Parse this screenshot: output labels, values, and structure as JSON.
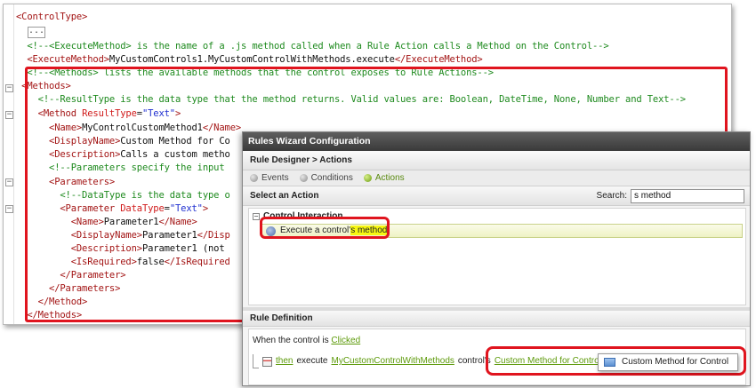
{
  "xml": {
    "lines": [
      {
        "parts": [
          {
            "c": "tag",
            "t": "<ControlType>"
          }
        ]
      },
      {
        "parts": []
      },
      {
        "parts": [
          {
            "c": "cmt",
            "t": "  <!--<ExecuteMethod> is the name of a .js method called when a Rule Action calls a Method on the Control-->"
          }
        ]
      },
      {
        "parts": [
          {
            "c": "tag",
            "t": "  <ExecuteMethod>"
          },
          {
            "c": "txt",
            "t": "MyCustomControls1.MyCustomControlWithMethods.execute"
          },
          {
            "c": "tag",
            "t": "</ExecuteMethod>"
          }
        ]
      },
      {
        "parts": [
          {
            "c": "cmt",
            "t": "  <!--<Methods> lists the available methods that the control exposes to Rule Actions-->"
          }
        ]
      },
      {
        "parts": [
          {
            "c": "tag",
            "t": " <Methods>"
          }
        ]
      },
      {
        "parts": [
          {
            "c": "cmt",
            "t": "    <!--ResultType is the data type that the method returns. Valid values are: Boolean, DateTime, None, Number and Text-->"
          }
        ]
      },
      {
        "parts": [
          {
            "c": "tag",
            "t": "    <Method "
          },
          {
            "c": "attr",
            "t": "ResultType"
          },
          {
            "c": "txt",
            "t": "="
          },
          {
            "c": "val",
            "t": "\"Text\""
          },
          {
            "c": "tag",
            "t": ">"
          }
        ]
      },
      {
        "parts": [
          {
            "c": "tag",
            "t": "      <Name>"
          },
          {
            "c": "txt",
            "t": "MyControlCustomMethod1"
          },
          {
            "c": "tag",
            "t": "</Name>"
          }
        ]
      },
      {
        "parts": [
          {
            "c": "tag",
            "t": "      <DisplayName>"
          },
          {
            "c": "txt",
            "t": "Custom Method for Co"
          }
        ]
      },
      {
        "parts": [
          {
            "c": "tag",
            "t": "      <Description>"
          },
          {
            "c": "txt",
            "t": "Calls a custom metho"
          }
        ]
      },
      {
        "parts": [
          {
            "c": "cmt",
            "t": "      <!--Parameters specify the input"
          }
        ]
      },
      {
        "parts": [
          {
            "c": "tag",
            "t": "      <Parameters>"
          }
        ]
      },
      {
        "parts": [
          {
            "c": "cmt",
            "t": "        <!--DataType is the data type o"
          }
        ]
      },
      {
        "parts": [
          {
            "c": "tag",
            "t": "        <Parameter "
          },
          {
            "c": "attr",
            "t": "DataType"
          },
          {
            "c": "txt",
            "t": "="
          },
          {
            "c": "val",
            "t": "\"Text\""
          },
          {
            "c": "tag",
            "t": ">"
          }
        ]
      },
      {
        "parts": [
          {
            "c": "tag",
            "t": "          <Name>"
          },
          {
            "c": "txt",
            "t": "Parameter1"
          },
          {
            "c": "tag",
            "t": "</Name>"
          }
        ]
      },
      {
        "parts": [
          {
            "c": "tag",
            "t": "          <DisplayName>"
          },
          {
            "c": "txt",
            "t": "Parameter1"
          },
          {
            "c": "tag",
            "t": "</Disp"
          }
        ]
      },
      {
        "parts": [
          {
            "c": "tag",
            "t": "          <Description>"
          },
          {
            "c": "txt",
            "t": "Parameter1 (not"
          }
        ]
      },
      {
        "parts": [
          {
            "c": "tag",
            "t": "          <IsRequired>"
          },
          {
            "c": "txt",
            "t": "false"
          },
          {
            "c": "tag",
            "t": "</IsRequired"
          }
        ]
      },
      {
        "parts": [
          {
            "c": "tag",
            "t": "        </Parameter>"
          }
        ]
      },
      {
        "parts": [
          {
            "c": "tag",
            "t": "      </Parameters>"
          }
        ]
      },
      {
        "parts": [
          {
            "c": "tag",
            "t": "    </Method>"
          }
        ]
      },
      {
        "parts": [
          {
            "c": "tag",
            "t": "  </Methods>"
          }
        ]
      }
    ],
    "collapsed_marker": "..."
  },
  "wizard": {
    "title": "Rules Wizard Configuration",
    "breadcrumb": "Rule Designer > Actions",
    "steps": [
      {
        "label": "Events",
        "active": false
      },
      {
        "label": "Conditions",
        "active": false
      },
      {
        "label": "Actions",
        "active": true
      }
    ],
    "select_action_label": "Select an Action",
    "search_label": "Search:",
    "search_value": "s method",
    "group_name": "Control Interaction",
    "action_prefix": "Execute a control'",
    "action_highlight": "s method",
    "rule_definition_label": "Rule Definition",
    "when_prefix": "When the control is",
    "when_link": "Clicked",
    "then_link": "then",
    "execute_word": "execute",
    "control_link": "MyCustomControlWithMethods",
    "control_suffix": "control's",
    "method_link": "Custom Method for Control",
    "dropdown_item": "Custom Method for Control"
  },
  "colors": {
    "highlight_box": "#e0141e",
    "link": "#5d9a0a",
    "search_highlight": "#f7f711"
  }
}
